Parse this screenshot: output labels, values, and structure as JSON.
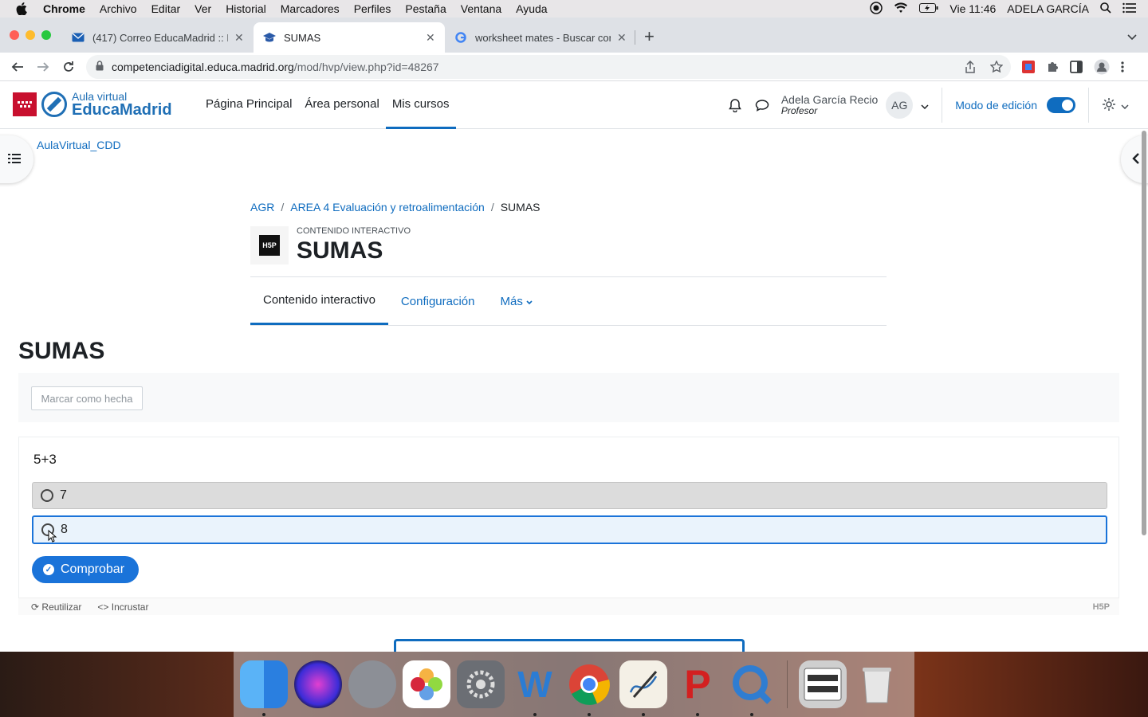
{
  "menubar": {
    "items": [
      "Chrome",
      "Archivo",
      "Editar",
      "Ver",
      "Historial",
      "Marcadores",
      "Perfiles",
      "Pestaña",
      "Ventana",
      "Ayuda"
    ],
    "clock": "Vie 11:46",
    "user": "ADELA GARCÍA"
  },
  "tabs": [
    {
      "title": "(417) Correo EducaMadrid :: En",
      "icon": "mail-icon"
    },
    {
      "title": "SUMAS",
      "icon": "moodle-icon"
    },
    {
      "title": "worksheet mates - Buscar con",
      "icon": "google-icon"
    }
  ],
  "address": {
    "domain": "competenciadigital.educa.madrid.org",
    "path": "/mod/hvp/view.php?id=48267"
  },
  "site": {
    "logo_line1": "Aula virtual",
    "logo_line2": "EducaMadrid",
    "nav": [
      "Página Principal",
      "Área personal",
      "Mis cursos"
    ],
    "user_name": "Adela García Recio",
    "user_role": "Profesor",
    "user_initials": "AG",
    "edit_mode": "Modo de edición",
    "course_link": "AulaVirtual_CDD"
  },
  "breadcrumb": [
    "AGR",
    "AREA 4 Evaluación y retroalimentación",
    "SUMAS"
  ],
  "activity": {
    "type": "CONTENIDO INTERACTIVO",
    "title": "SUMAS",
    "tabs": [
      "Contenido interactivo",
      "Configuración",
      "Más"
    ],
    "heading": "SUMAS",
    "complete_button": "Marcar como hecha"
  },
  "quiz": {
    "question": "5+3",
    "answers": [
      "7",
      "8"
    ],
    "check_button": "Comprobar",
    "reuse": "Reutilizar",
    "embed": "Incrustar",
    "brand": "H5P"
  },
  "colors": {
    "moodle_blue": "#0f6cbf",
    "h5p_blue": "#1a73d9"
  }
}
